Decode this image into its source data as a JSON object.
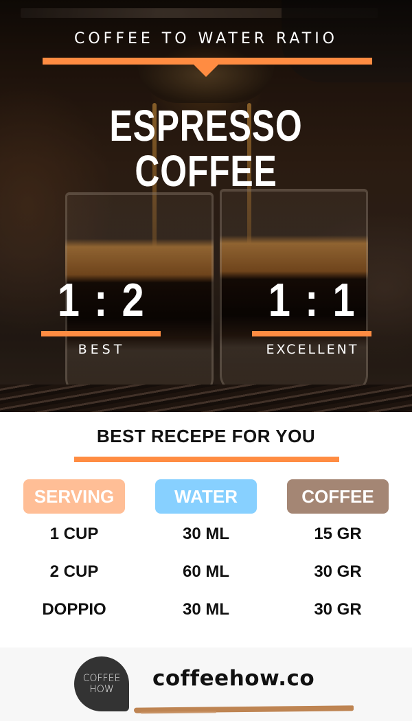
{
  "hero": {
    "kicker": "COFFEE TO WATER RATIO",
    "title_line1": "ESPRESSO",
    "title_line2": "COFFEE",
    "ratios": [
      {
        "value": "1 : 2",
        "label": "BEST"
      },
      {
        "value": "1 : 1",
        "label": "EXCELLENT"
      }
    ]
  },
  "recipe": {
    "title": "BEST RECEPE FOR YOU",
    "columns": [
      {
        "header": "SERVING",
        "color": "#ffbe96",
        "values": [
          "1 CUP",
          "2 CUP",
          "DOPPIO"
        ]
      },
      {
        "header": "WATER",
        "color": "#87d0ff",
        "values": [
          "30 ML",
          "60 ML",
          "30 ML"
        ]
      },
      {
        "header": "COFFEE",
        "color": "#a48674",
        "values": [
          "15 GR",
          "30 GR",
          "30 GR"
        ]
      }
    ]
  },
  "footer": {
    "logo_line1": "COFFEE",
    "logo_line2": "HOW",
    "site": "coffeehow.co"
  },
  "colors": {
    "accent": "#ff8c42",
    "brush": "#be8452",
    "logo_bg": "#333333",
    "footer_bg": "#f7f7f7"
  }
}
